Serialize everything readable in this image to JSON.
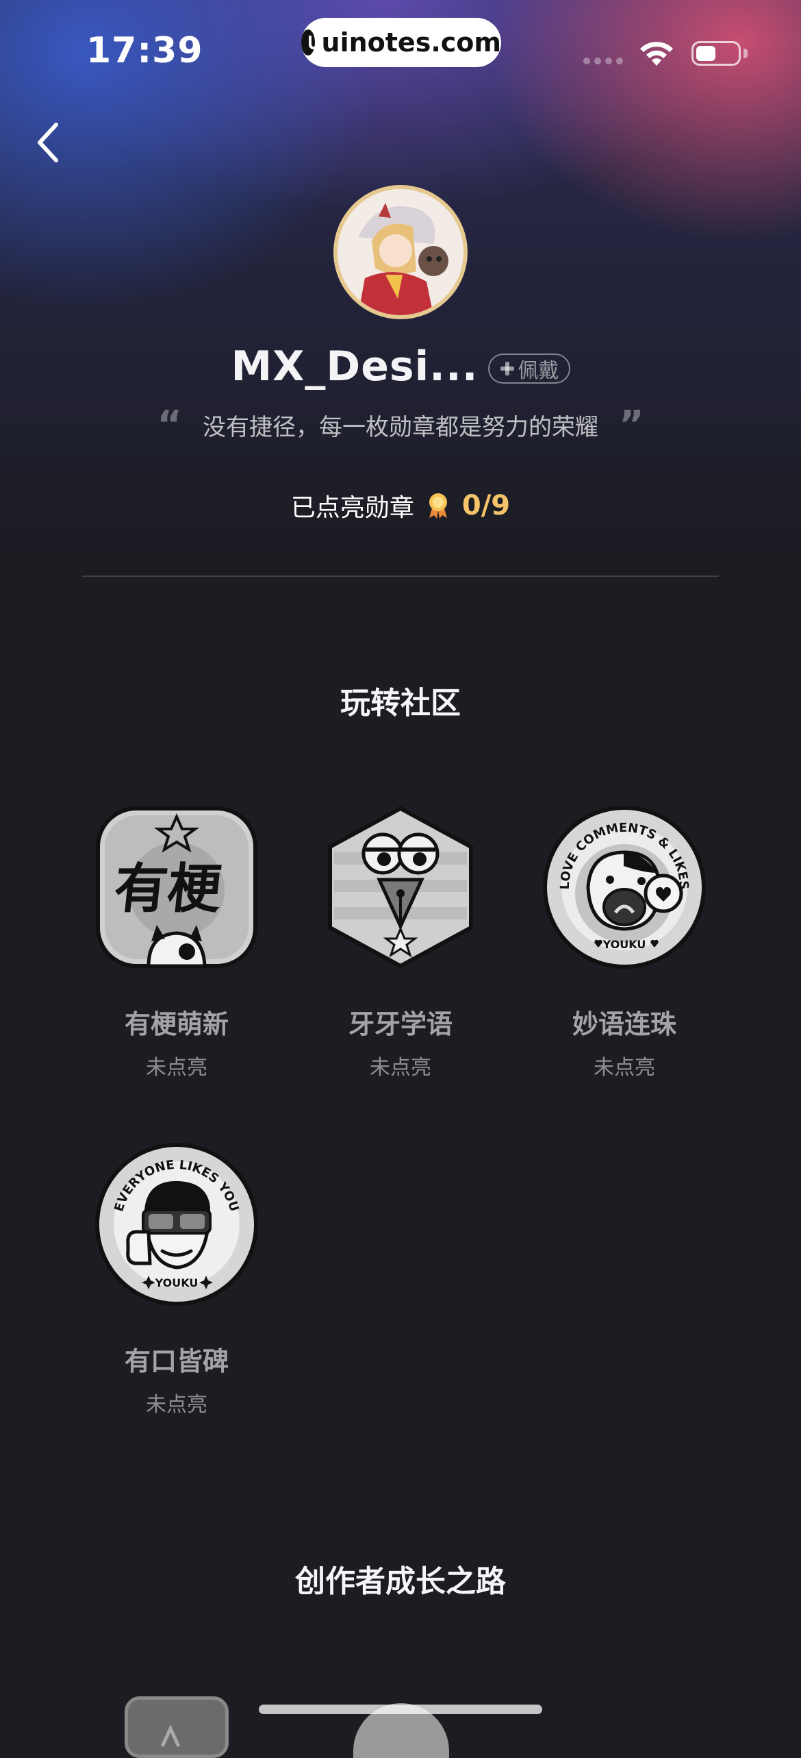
{
  "status_bar": {
    "time": "17:39",
    "url": "uinotes.com"
  },
  "profile": {
    "username": "MX_Desi...",
    "wear_label": "佩戴",
    "motto": "没有捷径，每一枚勋章都是努力的荣耀",
    "lit_label": "已点亮勋章",
    "lit_count": "0/9"
  },
  "sections": [
    {
      "title": "玩转社区",
      "badges": [
        {
          "name": "有梗萌新",
          "status": "未点亮",
          "icon": "youyouge-badge-icon",
          "art_text": "有梗"
        },
        {
          "name": "牙牙学语",
          "status": "未点亮",
          "icon": "pen-owl-badge-icon"
        },
        {
          "name": "妙语连珠",
          "status": "未点亮",
          "icon": "love-comments-badge-icon",
          "art_text": "LOVE COMMENTS & LIKES",
          "art_brand": "YOUKU"
        },
        {
          "name": "有口皆碑",
          "status": "未点亮",
          "icon": "everyone-likes-badge-icon",
          "art_text": "EVERYONE LIKES YOU",
          "art_brand": "YOUKU"
        }
      ]
    },
    {
      "title": "创作者成长之路"
    }
  ],
  "colors": {
    "accent_gold": "#f5c46a",
    "background": "#1c1c22",
    "avatar_border": "#e6c990"
  }
}
